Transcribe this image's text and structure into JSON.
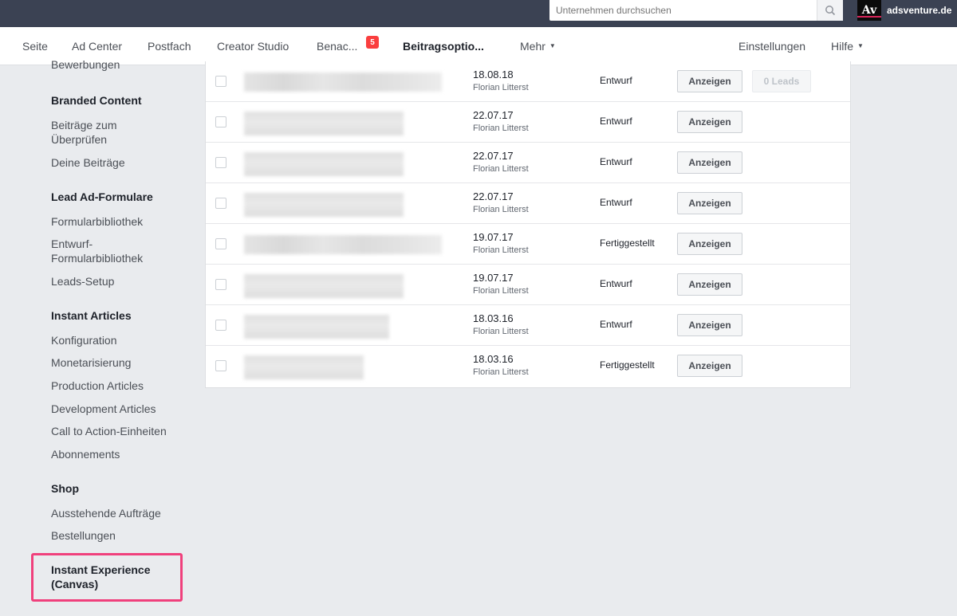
{
  "topbar": {
    "search_placeholder": "Unternehmen durchsuchen",
    "brand_logo": "Av",
    "brand_name": "adsventure.de"
  },
  "nav": {
    "seite": "Seite",
    "ad_center": "Ad Center",
    "postfach": "Postfach",
    "creator_studio": "Creator Studio",
    "benachrichtigungen": "Benac...",
    "badge_count": "5",
    "beitragsoptionen": "Beitragsoptio...",
    "mehr": "Mehr",
    "einstellungen": "Einstellungen",
    "hilfe": "Hilfe"
  },
  "sidebar": {
    "cut_item": "Bewerbungen",
    "branded_content": "Branded Content",
    "beitraege_pruefen": "Beiträge zum Überprüfen",
    "deine_beitraege": "Deine Beiträge",
    "lead_ad_formulare": "Lead Ad-Formulare",
    "formularbibliothek": "Formularbibliothek",
    "entwurf_formularbibliothek": "Entwurf-Formularbibliothek",
    "leads_setup": "Leads-Setup",
    "instant_articles": "Instant Articles",
    "konfiguration": "Konfiguration",
    "monetarisierung": "Monetarisierung",
    "production_articles": "Production Articles",
    "development_articles": "Development Articles",
    "call_to_action": "Call to Action-Einheiten",
    "abonnements": "Abonnements",
    "shop": "Shop",
    "ausstehende_auftraege": "Ausstehende Aufträge",
    "bestellungen": "Bestellungen",
    "instant_experience": "Instant Experience (Canvas)"
  },
  "forms": {
    "rows": [
      {
        "date": "18.08.18",
        "author": "Florian Litterst",
        "status": "Entwurf",
        "button": "Anzeigen",
        "leads": "0 Leads"
      },
      {
        "date": "22.07.17",
        "author": "Florian Litterst",
        "status": "Entwurf",
        "button": "Anzeigen"
      },
      {
        "date": "22.07.17",
        "author": "Florian Litterst",
        "status": "Entwurf",
        "button": "Anzeigen"
      },
      {
        "date": "22.07.17",
        "author": "Florian Litterst",
        "status": "Entwurf",
        "button": "Anzeigen"
      },
      {
        "date": "19.07.17",
        "author": "Florian Litterst",
        "status": "Fertiggestellt",
        "button": "Anzeigen"
      },
      {
        "date": "19.07.17",
        "author": "Florian Litterst",
        "status": "Entwurf",
        "button": "Anzeigen"
      },
      {
        "date": "18.03.16",
        "author": "Florian Litterst",
        "status": "Entwurf",
        "button": "Anzeigen"
      },
      {
        "date": "18.03.16",
        "author": "Florian Litterst",
        "status": "Fertiggestellt",
        "button": "Anzeigen"
      }
    ]
  },
  "colors": {
    "topbar": "#3b4253",
    "accent": "#4267b2",
    "badge": "#fa3e3e",
    "highlight": "#f0407c"
  }
}
